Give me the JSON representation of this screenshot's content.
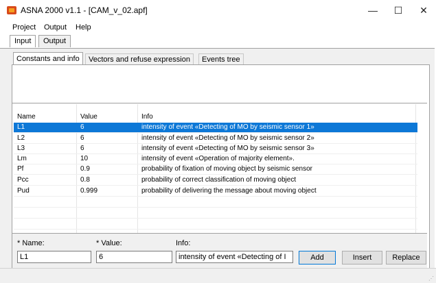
{
  "window": {
    "title": "ASNA 2000 v1.1 - [CAM_v_02.apf]",
    "minimize": "—",
    "maximize": "☐",
    "close": "✕"
  },
  "menu": {
    "items": [
      "Project",
      "Output",
      "Help"
    ]
  },
  "outer_tabs": [
    "Input",
    "Output"
  ],
  "inner_tabs": [
    "Constants and info",
    "Vectors and refuse expression",
    "Events tree"
  ],
  "table": {
    "headers": [
      "Name",
      "Value",
      "Info"
    ],
    "rows": [
      {
        "name": "L1",
        "value": "6",
        "info": "intensity of event «Detecting of MO by seismic sensor 1»"
      },
      {
        "name": "L2",
        "value": "6",
        "info": "intensity of event «Detecting of MO by seismic sensor 2»"
      },
      {
        "name": "L3",
        "value": "6",
        "info": "intensity of event «Detecting of MO by seismic sensor 3»"
      },
      {
        "name": "Lm",
        "value": "10",
        "info": "intensity of event «Operation of  majority element»."
      },
      {
        "name": "Pf",
        "value": "0.9",
        "info": "probability of fixation of moving object by seismic sensor"
      },
      {
        "name": "Pcc",
        "value": "0.8",
        "info": "probability of correct classification of moving object"
      },
      {
        "name": "Pud",
        "value": "0.999",
        "info": "probability of delivering the message about moving object"
      }
    ]
  },
  "form": {
    "name_label": "* Name:",
    "value_label": "* Value:",
    "info_label": "Info:",
    "name_value": "L1",
    "value_value": "6",
    "info_value": "intensity of event «Detecting of I",
    "add_label": "Add",
    "insert_label": "Insert",
    "replace_label": "Replace"
  },
  "colors": {
    "selection": "#0d78d7",
    "panel": "#f0f0f0"
  }
}
